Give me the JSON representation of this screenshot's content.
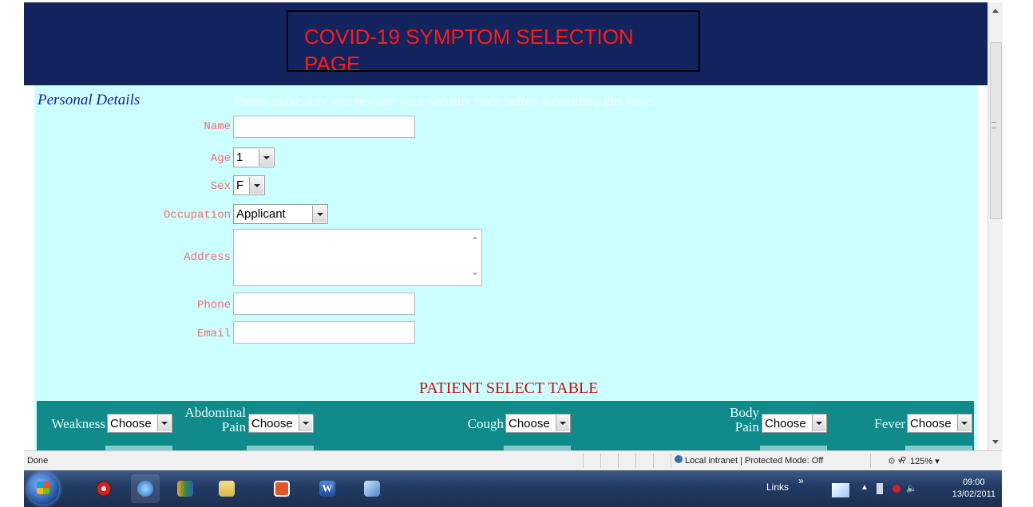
{
  "page": {
    "title": "COVID-19 SYMPTOM SELECTION PAGE",
    "section_title": "Personal Details",
    "notice": "Please make sure you re-enter your security code before submitting this form"
  },
  "form": {
    "name_label": "Name",
    "age_label": "Age",
    "age_value": "1",
    "sex_label": "Sex",
    "sex_value": "F",
    "occupation_label": "Occupation",
    "occupation_value": "Applicant",
    "address_label": "Address",
    "phone_label": "Phone",
    "email_label": "Email"
  },
  "table": {
    "title": "PATIENT SELECT TABLE",
    "symptoms": [
      {
        "label": "Weakness",
        "value": "Choose"
      },
      {
        "label": "Abdominal Pain",
        "value": "Choose"
      },
      {
        "label": "Cough",
        "value": "Choose"
      },
      {
        "label": "Body Pain",
        "value": "Choose"
      },
      {
        "label": "Fever",
        "value": "Choose"
      }
    ]
  },
  "statusbar": {
    "status": "Done",
    "zone": "Local intranet | Protected Mode: Off",
    "zoom": "125%"
  },
  "taskbar": {
    "links_label": "Links",
    "time": "09:00",
    "date": "13/02/2011",
    "apps": [
      "chrome-icon",
      "internet-explorer-icon",
      "media-player-icon",
      "file-explorer-icon",
      "xampp-icon",
      "word-icon",
      "misc-app-icon"
    ]
  },
  "colors": {
    "header_bg": "#13235e",
    "title_text": "#ff1a1a",
    "form_bg": "#ccffff",
    "symptom_band": "#108a8a",
    "label_color": "#f26c6c"
  }
}
